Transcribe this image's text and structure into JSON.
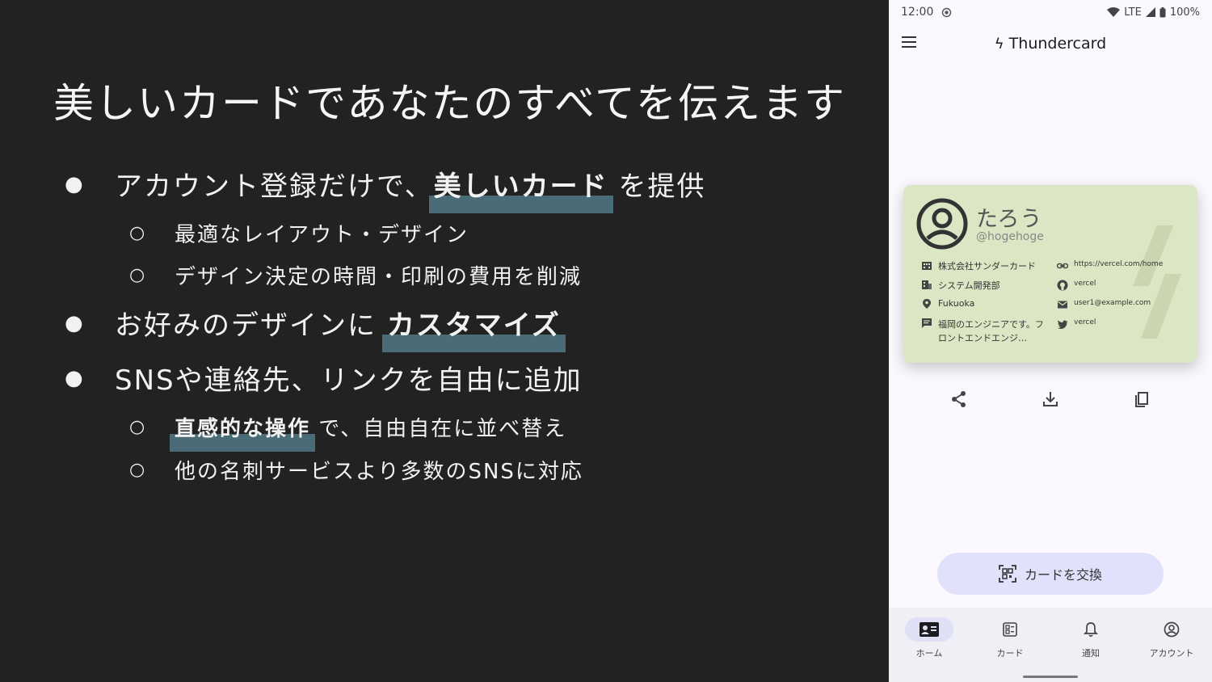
{
  "slide": {
    "title": "美しいカードであなたのすべてを伝えます",
    "bullets": [
      {
        "pre": "アカウント登録だけで、",
        "highlight": "美しいカード",
        "post": " を提供"
      },
      {
        "text": "最適なレイアウト・デザイン"
      },
      {
        "text": "デザイン決定の時間・印刷の費用を削減"
      },
      {
        "pre": "お好みのデザインに ",
        "highlight": "カスタマイズ",
        "post": ""
      },
      {
        "text": "SNSや連絡先、リンクを自由に追加"
      },
      {
        "pre": "",
        "highlight": "直感的な操作",
        "post": " で、自由自在に並べ替え"
      },
      {
        "text": "他の名刺サービスより多数のSNSに対応"
      }
    ],
    "bullet_symbol": "●",
    "sub_bullet_symbol": "○",
    "highlight_color": "#4a6c76"
  },
  "phone": {
    "status": {
      "time": "12:00",
      "network": "LTE",
      "battery": "100%"
    },
    "app_title": "Thundercard",
    "card": {
      "name": "たろう",
      "handle": "@hogehoge",
      "company": "株式会社サンダーカード",
      "department": "システム開発部",
      "location": "Fukuoka",
      "bio": "福岡のエンジニアです。フロントエンドエンジ…",
      "link": "https://vercel.com/home",
      "github": "vercel",
      "email": "user1@example.com",
      "twitter": "vercel",
      "background": "#dbe6c4"
    },
    "exchange_label": "カードを交換",
    "nav": [
      {
        "label": "ホーム",
        "icon": "contact-card-icon",
        "active": true
      },
      {
        "label": "カード",
        "icon": "card-list-icon",
        "active": false
      },
      {
        "label": "通知",
        "icon": "bell-icon",
        "active": false
      },
      {
        "label": "アカウント",
        "icon": "account-circle-icon",
        "active": false
      }
    ]
  }
}
